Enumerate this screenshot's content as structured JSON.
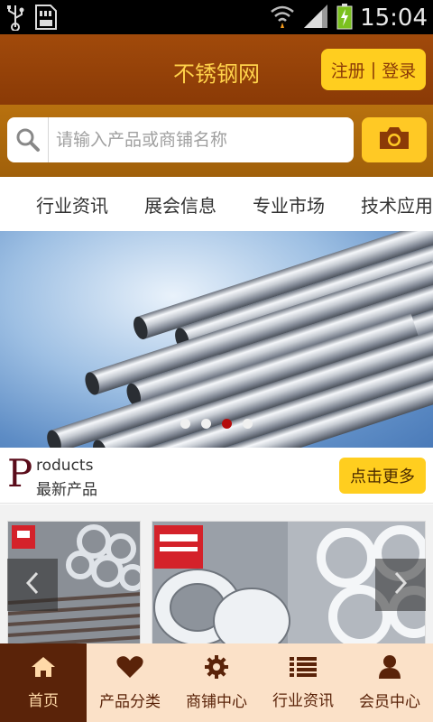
{
  "status_bar": {
    "time": "15:04",
    "icons": [
      "usb-icon",
      "sd-card-icon",
      "wifi-icon",
      "signal-icon",
      "battery-charging-icon"
    ]
  },
  "header": {
    "title": "不锈钢网",
    "register_label": "注册",
    "separator": "|",
    "login_label": "登录"
  },
  "search": {
    "placeholder": "请输入产品或商铺名称",
    "icon": "search-icon",
    "camera_icon": "camera-icon"
  },
  "category_tabs": [
    "行业资讯",
    "展会信息",
    "专业市场",
    "技术应用"
  ],
  "banner": {
    "dots": 4,
    "active_dot": 3
  },
  "products_section": {
    "big_letter": "P",
    "en_rest": "roducts",
    "cn_title": "最新产品",
    "more_label": "点击更多"
  },
  "bottom_nav": [
    {
      "label": "首页",
      "icon": "home-icon",
      "active": true
    },
    {
      "label": "产品分类",
      "icon": "heart-icon",
      "active": false
    },
    {
      "label": "商铺中心",
      "icon": "gear-icon",
      "active": false
    },
    {
      "label": "行业资讯",
      "icon": "list-icon",
      "active": false
    },
    {
      "label": "会员中心",
      "icon": "user-icon",
      "active": false
    }
  ],
  "colors": {
    "header_brown": "#8a3a06",
    "accent_yellow": "#ffce1f",
    "title_yellow": "#ffd24a",
    "nav_bg": "#fbe1c8",
    "nav_active": "#5a2309"
  }
}
